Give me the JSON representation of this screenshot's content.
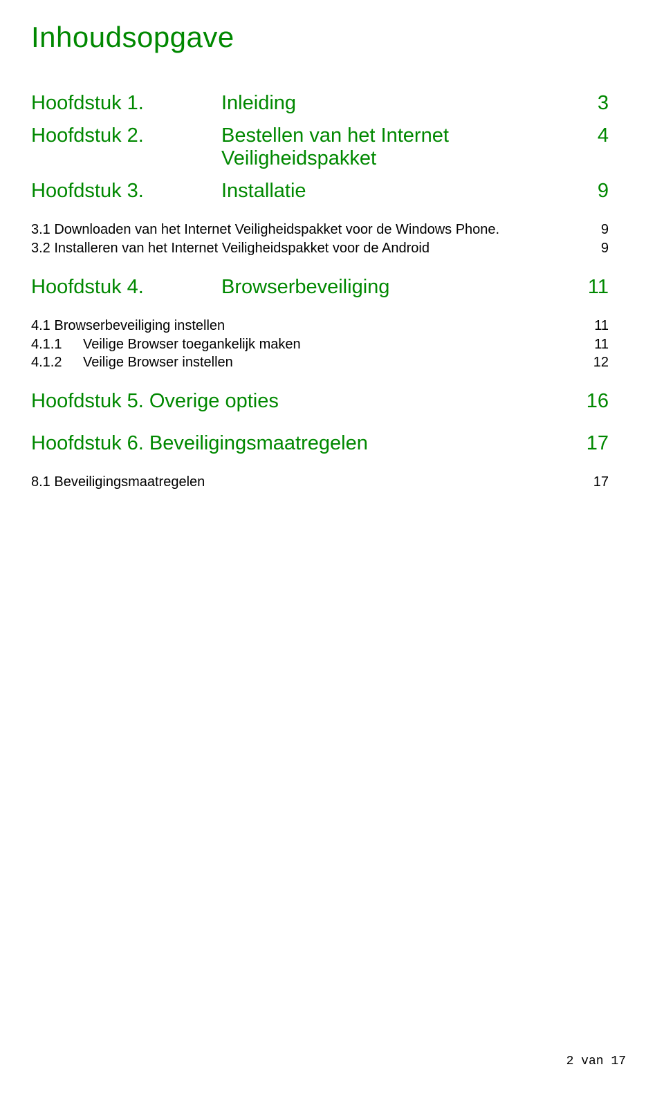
{
  "title": "Inhoudsopgave",
  "chapters": [
    {
      "label": "Hoofdstuk 1.",
      "title": "Inleiding",
      "page": "3"
    },
    {
      "label": "Hoofdstuk 2.",
      "title": "Bestellen van het Internet Veiligheidspakket",
      "page": "4"
    },
    {
      "label": "Hoofdstuk 3.",
      "title": "Installatie",
      "page": "9"
    }
  ],
  "subs3": [
    {
      "title": "3.1 Downloaden van het Internet Veiligheidspakket voor de Windows Phone.",
      "page": "9"
    },
    {
      "title": "3.2 Installeren van het Internet Veiligheidspakket voor de Android",
      "page": "9"
    }
  ],
  "chapter4": {
    "label": "Hoofdstuk 4.",
    "title": "Browserbeveiliging",
    "page": "11"
  },
  "subs4": [
    {
      "title": "4.1 Browserbeveiliging instellen",
      "page": "11"
    }
  ],
  "subsubs4": [
    {
      "num": "4.1.1",
      "title": "Veilige Browser toegankelijk maken",
      "page": "11"
    },
    {
      "num": "4.1.2",
      "title": "Veilige Browser instellen",
      "page": "12"
    }
  ],
  "chapter5": {
    "combined": "Hoofdstuk 5. Overige opties",
    "page": "16"
  },
  "chapter6": {
    "combined": "Hoofdstuk 6. Beveiligingsmaatregelen",
    "page": "17"
  },
  "subs8": [
    {
      "title": "8.1 Beveiligingsmaatregelen",
      "page": "17"
    }
  ],
  "footer": "2 van 17"
}
